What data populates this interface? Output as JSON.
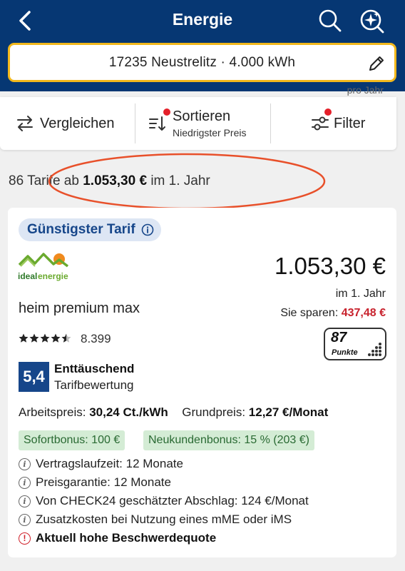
{
  "header": {
    "title": "Energie"
  },
  "search": {
    "query": "17235 Neustrelitz · 4.000 kWh"
  },
  "peek_text": "pro Jahr",
  "toolbar": {
    "compare": "Vergleichen",
    "sort_label": "Sortieren",
    "sort_value": "Niedrigster Preis",
    "filter": "Filter"
  },
  "results": {
    "prefix": "86 Tarife ab",
    "price": "1.053,30 €",
    "suffix": "im 1. Jahr"
  },
  "card": {
    "badge": "Günstigster Tarif",
    "provider": "idealenergie",
    "tariff_name": "heim premium max",
    "price": "1.053,30 €",
    "period": "im 1. Jahr",
    "savings_label": "Sie sparen:",
    "savings_amount": "437,48 €",
    "rating_stars": 4.5,
    "rating_count": "8.399",
    "punkte_value": "87",
    "punkte_label": "Punkte",
    "score": "5,4",
    "score_label": "Enttäuschend",
    "score_sub": "Tarifbewertung",
    "arbeitspreis_label": "Arbeitspreis:",
    "arbeitspreis_value": "30,24 Ct./kWh",
    "grundpreis_label": "Grundpreis:",
    "grundpreis_value": "12,27 €/Monat",
    "bonuses": [
      "Sofortbonus: 100 €",
      "Neukundenbonus: 15 % (203 €)"
    ],
    "info_lines": [
      "Vertragslaufzeit: 12 Monate",
      "Preisgarantie: 12 Monate",
      "Von CHECK24 geschätzter Abschlag: 124 €/Monat",
      "Zusatzkosten bei Nutzung eines mME oder iMS"
    ],
    "warning": "Aktuell hohe Beschwerdequote"
  },
  "colors": {
    "header_bg": "#063773",
    "search_border": "#f2b81c",
    "brand_blue": "#16468a",
    "savings_red": "#c8222d",
    "bonus_bg": "#d4ecd5",
    "annotation": "#e8502a"
  }
}
